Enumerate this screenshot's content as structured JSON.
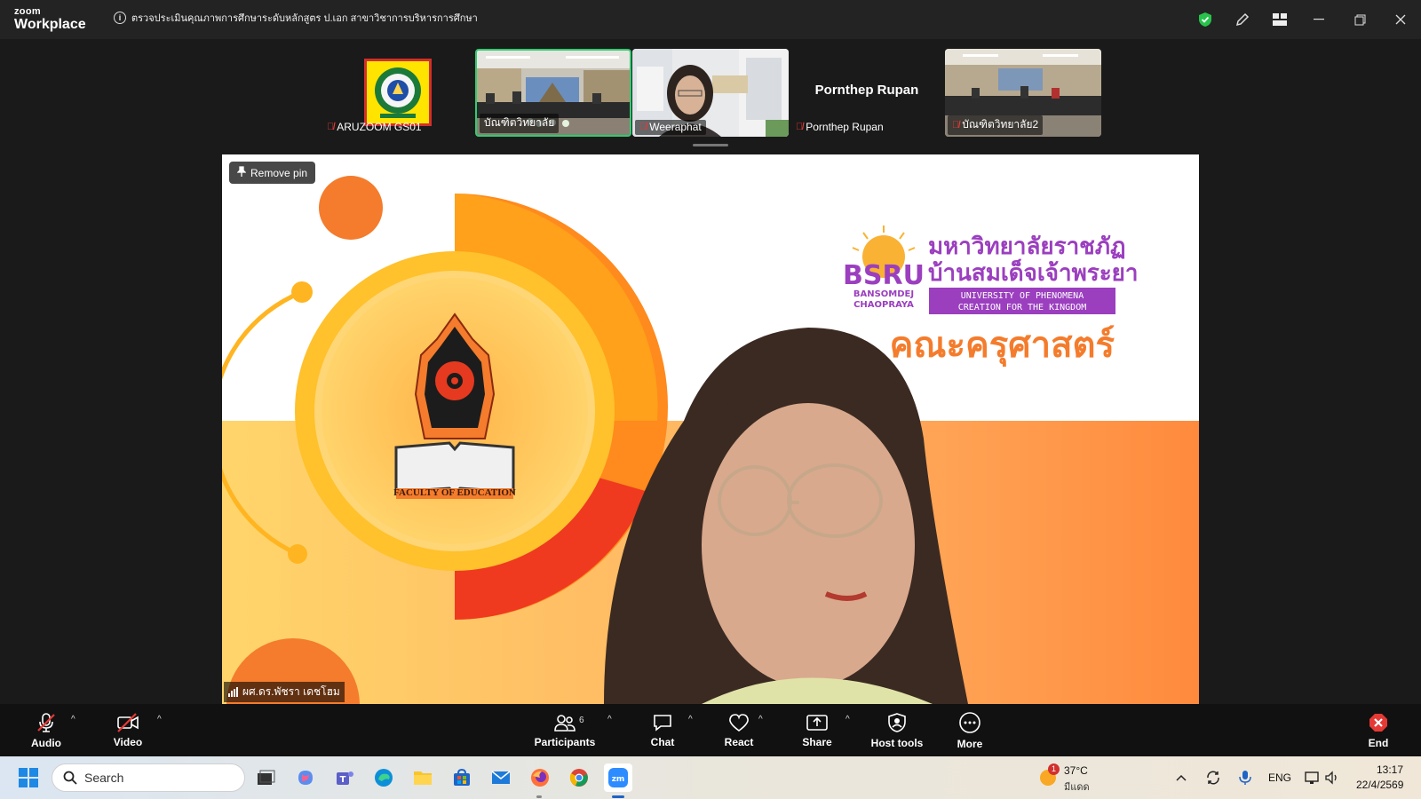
{
  "app": {
    "brand_line1": "zoom",
    "brand_line2": "Workplace",
    "meeting_title": "ตรวจประเมินคุณภาพการศึกษาระดับหลักสูตร ป.เอก สาขาวิชาการบริหารการศึกษา"
  },
  "participants_strip": [
    {
      "name": "ARUZOOM GS01",
      "muted": true,
      "active": false
    },
    {
      "name": "บัณฑิตวิทยาลัย",
      "muted": false,
      "active": true
    },
    {
      "name": "Weeraphat",
      "muted": true,
      "active": false
    },
    {
      "name": "Pornthep Rupan",
      "muted": true,
      "active": false,
      "display_name": "Pornthep Rupan"
    },
    {
      "name": "บัณฑิตวิทยาลัย2",
      "muted": true,
      "active": false
    }
  ],
  "main_video": {
    "remove_pin_label": "Remove pin",
    "speaker_name": "ผศ.ดร.พัชรา เดชโฮม",
    "slide": {
      "university_thai_1": "มหาวิทยาลัยราชภัฏ",
      "university_thai_2": "บ้านสมเด็จเจ้าพระยา",
      "univ_abbr": "BSRU",
      "univ_en_1": "BANSOMDEJ",
      "univ_en_2": "CHAOPRAYA",
      "tagline_1": "UNIVERSITY OF PHENOMENA",
      "tagline_2": "CREATION FOR THE KINGDOM",
      "faculty_thai": "คณะครุศาสตร์",
      "faculty_en": "FACULTY OF EDUCATION"
    }
  },
  "toolbar": {
    "audio": "Audio",
    "video": "Video",
    "participants": "Participants",
    "participants_count": "6",
    "chat": "Chat",
    "react": "React",
    "share": "Share",
    "host_tools": "Host tools",
    "more": "More",
    "end": "End"
  },
  "taskbar": {
    "search_placeholder": "Search",
    "weather_temp": "37°C",
    "weather_desc": "มีแดด",
    "weather_badge": "1",
    "language": "ENG",
    "time": "13:17",
    "date": "22/4/2569"
  },
  "colors": {
    "accent_green": "#2ecc71",
    "end_red": "#e53935",
    "slide_orange": "#f7931e",
    "slide_purple": "#9b3fbf"
  }
}
